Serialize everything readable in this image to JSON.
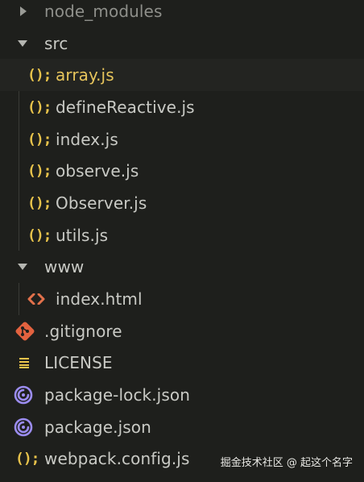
{
  "explorer": {
    "items": [
      {
        "label": "node_modules",
        "type": "folder-collapsed"
      },
      {
        "label": "src",
        "type": "folder-expanded"
      },
      {
        "label": "array.js",
        "type": "js",
        "selected": true
      },
      {
        "label": "defineReactive.js",
        "type": "js"
      },
      {
        "label": "index.js",
        "type": "js"
      },
      {
        "label": "observe.js",
        "type": "js"
      },
      {
        "label": "Observer.js",
        "type": "js"
      },
      {
        "label": "utils.js",
        "type": "js"
      },
      {
        "label": "www",
        "type": "folder-expanded"
      },
      {
        "label": "index.html",
        "type": "html"
      },
      {
        "label": ".gitignore",
        "type": "git"
      },
      {
        "label": "LICENSE",
        "type": "license"
      },
      {
        "label": "package-lock.json",
        "type": "npm"
      },
      {
        "label": "package.json",
        "type": "npm"
      },
      {
        "label": "webpack.config.js",
        "type": "js"
      }
    ],
    "js_icon_glyph": "();"
  },
  "watermark": {
    "text": "掘金技术社区 @ 起这个名字"
  },
  "colors": {
    "background": "#1e1f1c",
    "text": "#c9cac5",
    "selected_text": "#e7c55c",
    "js_icon": "#e8c34b",
    "html_icon": "#e2714b",
    "git_icon": "#e2623f",
    "npm_icon": "#9b8cf0"
  }
}
